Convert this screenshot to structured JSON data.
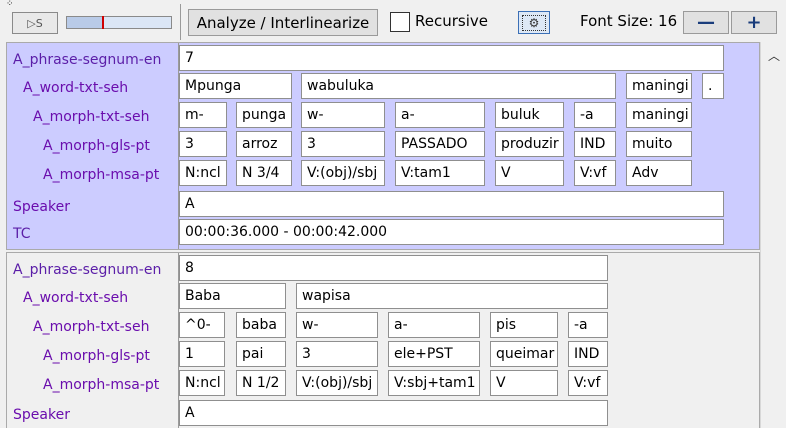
{
  "toolbar": {
    "play_label": "▷S",
    "slider_fraction": 0.34,
    "analyze_label": "Analyze / Interlinearize",
    "recursive_label": "Recursive",
    "gear_icon": "⚙",
    "font_size_label": "Font Size: 16",
    "minus_label": "—",
    "plus_label": "+"
  },
  "tiers": {
    "phrase": "A_phrase-segnum-en",
    "word": "A_word-txt-seh",
    "morph_txt": "A_morph-txt-seh",
    "morph_gls": "A_morph-gls-pt",
    "morph_msa": "A_morph-msa-pt",
    "speaker": "Speaker",
    "tc": "TC"
  },
  "block1": {
    "phrase": "7",
    "words": [
      "Mpunga",
      "wabuluka",
      "maningi",
      "."
    ],
    "morph_txt": [
      "m-",
      "punga",
      "w-",
      "a-",
      "buluk",
      "-a",
      "maningi"
    ],
    "morph_gls": [
      "3",
      "arroz",
      "3",
      "PASSADO",
      "produzir",
      "IND",
      "muito"
    ],
    "morph_msa": [
      "N:ncl",
      "N 3/4",
      "V:(obj)/sbj",
      "V:tam1",
      "V",
      "V:vf",
      "Adv"
    ],
    "speaker": "A",
    "tc": "00:00:36.000 - 00:00:42.000"
  },
  "block2": {
    "phrase": "8",
    "words": [
      "Baba",
      "wapisa"
    ],
    "morph_txt": [
      "^0-",
      "baba",
      "w-",
      "a-",
      "pis",
      "-a"
    ],
    "morph_gls": [
      "1",
      "pai",
      "3",
      "ele+PST",
      "queimar",
      "IND"
    ],
    "morph_msa": [
      "N:ncl",
      "N 1/2",
      "V:(obj)/sbj",
      "V:sbj+tam1",
      "V",
      "V:vf"
    ],
    "speaker": "A"
  }
}
